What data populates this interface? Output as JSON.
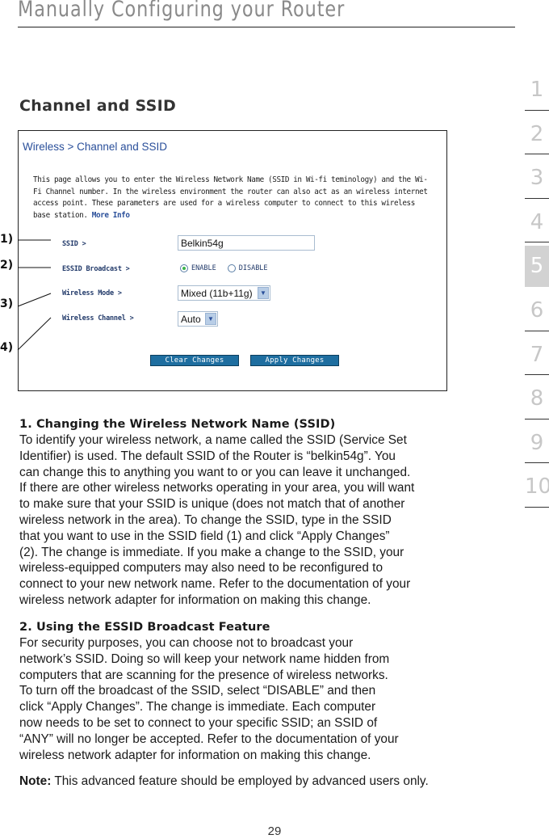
{
  "header": {
    "title": "Manually Configuring your Router"
  },
  "section_title": "Channel and SSID",
  "side_nav": {
    "items": [
      "1",
      "2",
      "3",
      "4",
      "5",
      "6",
      "7",
      "8",
      "9",
      "10"
    ],
    "active": "5"
  },
  "router_ui": {
    "breadcrumb": "Wireless > Channel and SSID",
    "intro": "This page allows you to enter the Wireless Network Name (SSID in Wi-fi teminology) and the Wi-Fi Channel number. In the wireless environment the router can also act as an wireless internet access point. These parameters are used for a wireless computer to connect to this wireless base station.",
    "more_info": "More Info",
    "fields": {
      "ssid_label": "SSID >",
      "ssid_value": "Belkin54g",
      "essid_label": "ESSID Broadcast >",
      "enable_label": "ENABLE",
      "disable_label": "DISABLE",
      "broadcast_selected": "ENABLE",
      "mode_label": "Wireless Mode >",
      "mode_value": "Mixed (11b+11g)",
      "channel_label": "Wireless Channel >",
      "channel_value": "Auto"
    },
    "buttons": {
      "clear": "Clear Changes",
      "apply": "Apply Changes"
    }
  },
  "callouts": [
    "1)",
    "2)",
    "3)",
    "4)"
  ],
  "sections": [
    {
      "heading": "1. Changing the Wireless Network Name (SSID)",
      "text": "To identify your wireless network, a name called the SSID (Service Set\nIdentifier) is used. The default SSID of the Router is “belkin54g”. You\ncan change this to anything you want to or you can leave it unchanged.\nIf there are other wireless networks operating in your area, you will want\nto make sure that your SSID is unique (does not match that of another\nwireless network in the area). To change the SSID, type in the SSID\nthat you want to use in the SSID field (1) and click “Apply Changes”\n(2). The change is immediate. If you make a change to the SSID, your\nwireless-equipped computers may also need to be reconfigured to\nconnect to your new network name. Refer to the documentation of your\nwireless network adapter for information on making this change."
    },
    {
      "heading": "2. Using the ESSID Broadcast Feature",
      "text": "For security purposes, you can choose not to broadcast your\nnetwork’s SSID. Doing so will keep your network name hidden from\ncomputers that are scanning for the presence of wireless networks.\nTo turn off the broadcast of the SSID, select “DISABLE” and then\nclick “Apply Changes”. The change is immediate. Each computer\nnow needs to be set to connect to your specific SSID; an SSID of\n“ANY” will no longer be accepted. Refer to the documentation of your\nwireless network adapter for information on making this change."
    }
  ],
  "note": {
    "label": "Note:",
    "text": " This advanced feature should be employed by advanced users only."
  },
  "page_number": "29"
}
